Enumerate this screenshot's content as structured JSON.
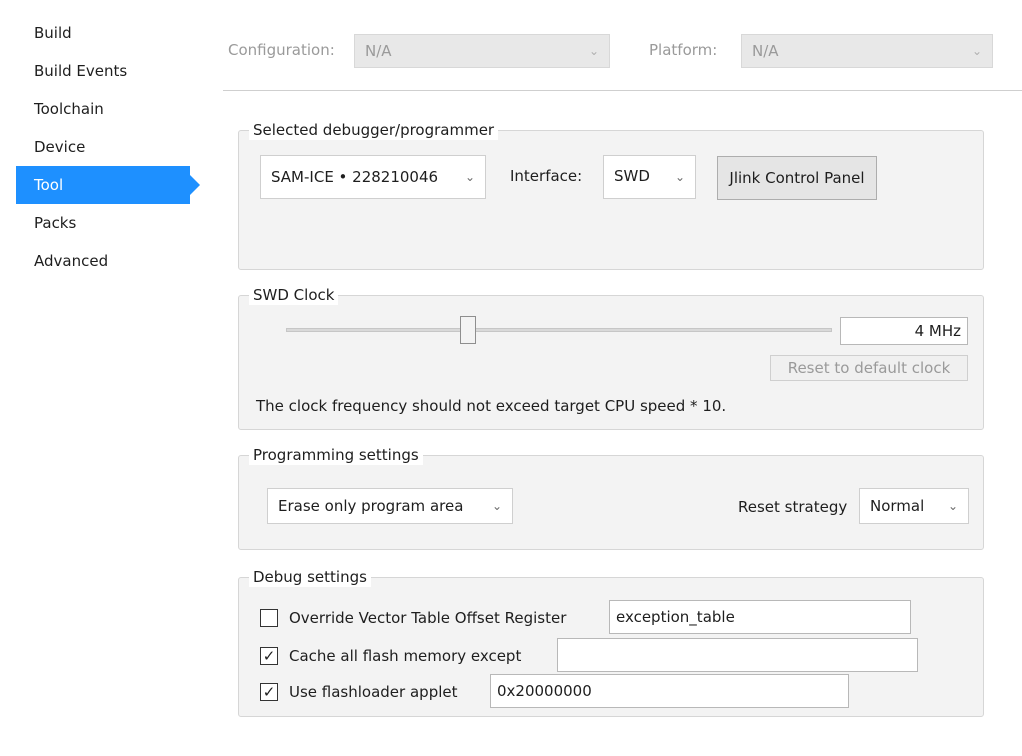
{
  "sidebar": {
    "items": [
      {
        "label": "Build"
      },
      {
        "label": "Build Events"
      },
      {
        "label": "Toolchain"
      },
      {
        "label": "Device"
      },
      {
        "label": "Tool"
      },
      {
        "label": "Packs"
      },
      {
        "label": "Advanced"
      }
    ],
    "active": "Tool"
  },
  "header": {
    "configuration_label": "Configuration:",
    "configuration_value": "N/A",
    "platform_label": "Platform:",
    "platform_value": "N/A"
  },
  "debugger": {
    "title": "Selected debugger/programmer",
    "device": "SAM-ICE • 228210046",
    "interface_label": "Interface:",
    "interface_value": "SWD",
    "control_panel_button": "Jlink Control Panel"
  },
  "swd_clock": {
    "title": "SWD Clock",
    "value": "4 MHz",
    "reset_button": "Reset to default clock",
    "note": "The clock frequency should not exceed target CPU speed * 10."
  },
  "programming": {
    "title": "Programming settings",
    "erase_option": "Erase only program area",
    "reset_strategy_label": "Reset strategy",
    "reset_strategy_value": "Normal"
  },
  "debug": {
    "title": "Debug settings",
    "override_vtor_label": "Override Vector Table Offset Register",
    "override_vtor_checked": false,
    "override_vtor_value": "exception_table",
    "cache_flash_label": "Cache all flash memory except",
    "cache_flash_checked": true,
    "cache_flash_value": "",
    "flashloader_label": "Use flashloader applet",
    "flashloader_checked": true,
    "flashloader_value": "0x20000000"
  },
  "icons": {
    "chevron": "chevron-down-icon",
    "check": "checkmark-icon"
  },
  "colors": {
    "accent": "#1e90ff"
  }
}
